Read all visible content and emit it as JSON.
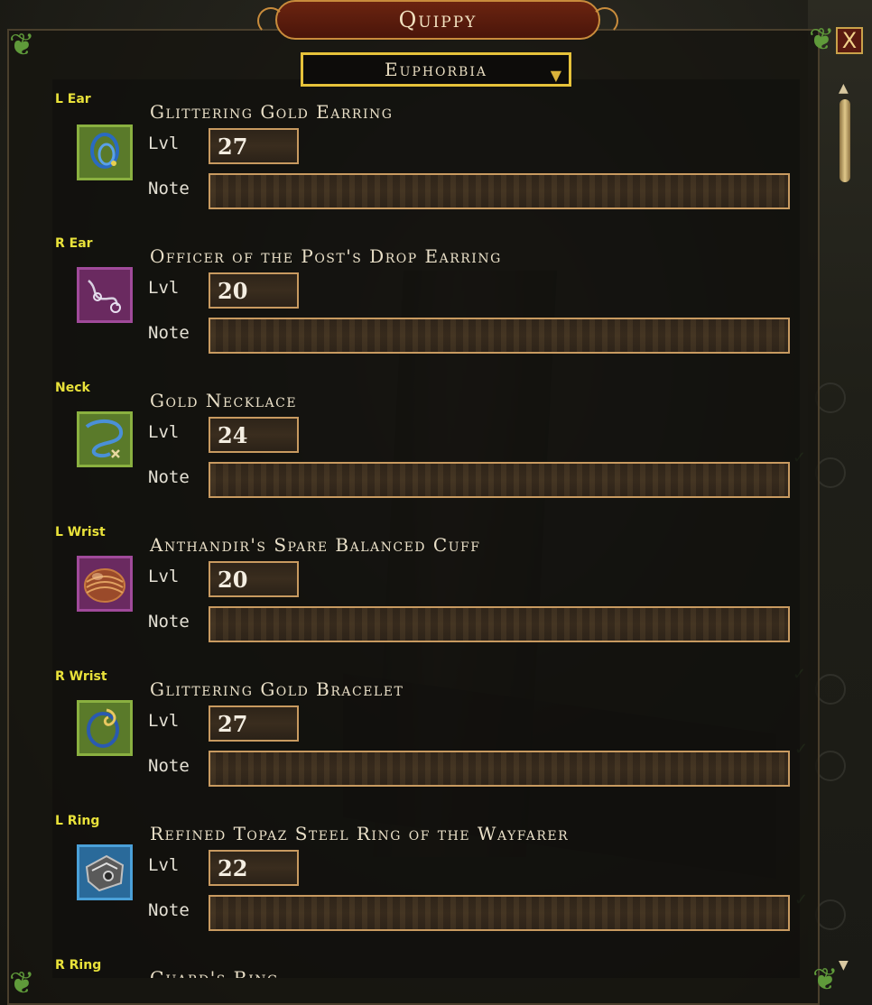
{
  "window": {
    "title": "Quippy"
  },
  "character_select": {
    "value": "Euphorbia"
  },
  "field_labels": {
    "level": "Lvl",
    "note": "Note"
  },
  "slots": [
    {
      "slot": "L Ear",
      "item": "Glittering Gold Earring",
      "level": "27",
      "note": "",
      "icon": "earring-icon",
      "frame_color": "#8ab040"
    },
    {
      "slot": "R Ear",
      "item": "Officer of the Post's Drop Earring",
      "level": "20",
      "note": "",
      "icon": "earring-icon",
      "frame_color": "#a04a9a"
    },
    {
      "slot": "Neck",
      "item": "Gold Necklace",
      "level": "24",
      "note": "",
      "icon": "necklace-icon",
      "frame_color": "#8ab040"
    },
    {
      "slot": "L Wrist",
      "item": "Anthandir's Spare Balanced Cuff",
      "level": "20",
      "note": "",
      "icon": "cuff-icon",
      "frame_color": "#a04a9a"
    },
    {
      "slot": "R Wrist",
      "item": "Glittering Gold Bracelet",
      "level": "27",
      "note": "",
      "icon": "bracelet-icon",
      "frame_color": "#8ab040"
    },
    {
      "slot": "L Ring",
      "item": "Refined Topaz Steel Ring of the Wayfarer",
      "level": "22",
      "note": "",
      "icon": "ring-icon",
      "frame_color": "#4aa0d8"
    },
    {
      "slot": "R Ring",
      "item": "Guard's Ring"
    }
  ]
}
